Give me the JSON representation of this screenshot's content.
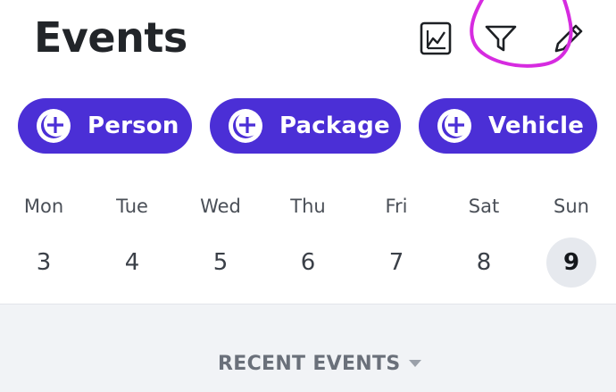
{
  "header": {
    "title": "Events",
    "icons": [
      {
        "name": "chart",
        "icon": "line-chart-icon"
      },
      {
        "name": "filter",
        "icon": "funnel-icon"
      },
      {
        "name": "edit",
        "icon": "pencil-icon"
      }
    ],
    "annotation_color": "#d62be0"
  },
  "chips": [
    {
      "label": "Person",
      "icon": "add-circle-icon"
    },
    {
      "label": "Package",
      "icon": "add-circle-icon"
    },
    {
      "label": "Vehicle",
      "icon": "add-circle-icon"
    }
  ],
  "week": {
    "days": [
      {
        "name": "Mon",
        "date": "3"
      },
      {
        "name": "Tue",
        "date": "4"
      },
      {
        "name": "Wed",
        "date": "5"
      },
      {
        "name": "Thu",
        "date": "6"
      },
      {
        "name": "Fri",
        "date": "7"
      },
      {
        "name": "Sat",
        "date": "8"
      },
      {
        "name": "Sun",
        "date": "9"
      }
    ],
    "selected_date": "9"
  },
  "recent": {
    "label": "RECENT EVENTS"
  },
  "colors": {
    "accent": "#4b2fd6",
    "selected_day_bg": "#e6e9ee",
    "section_bg": "#f1f3f6"
  }
}
